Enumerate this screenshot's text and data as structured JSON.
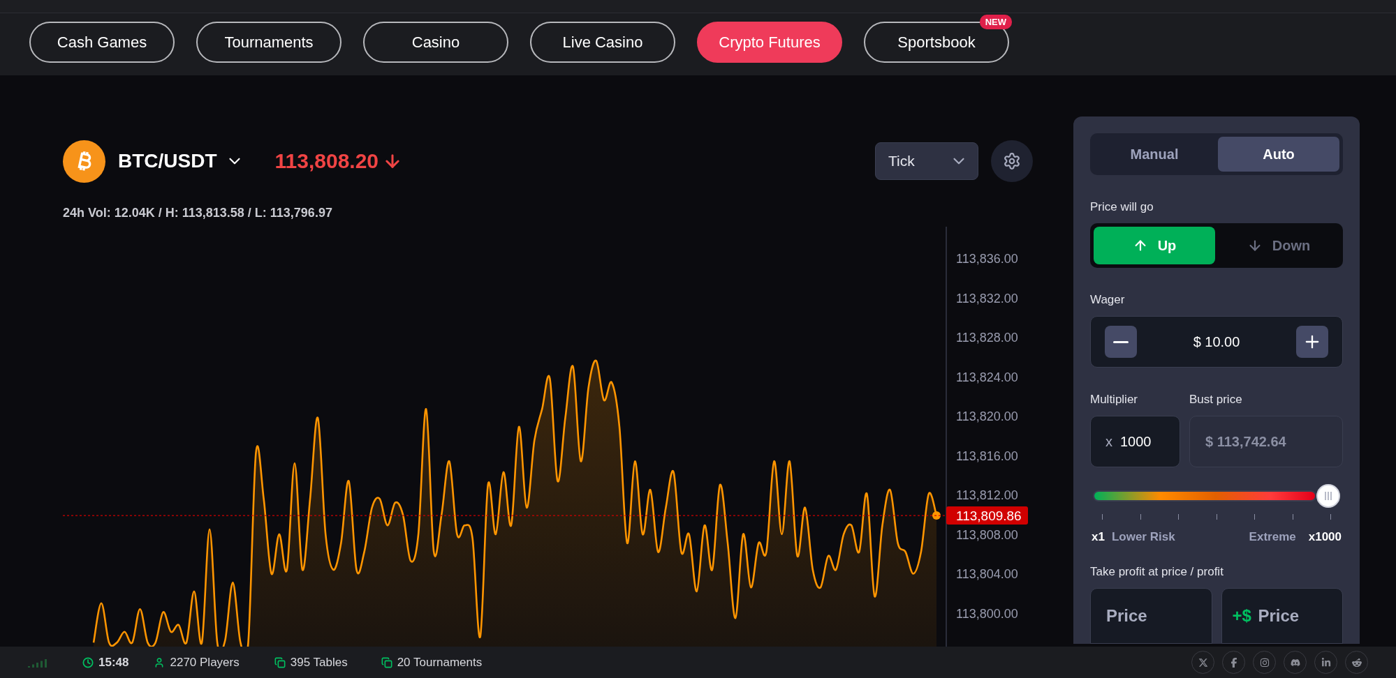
{
  "nav": {
    "tabs": [
      {
        "label": "Cash Games",
        "selected": false
      },
      {
        "label": "Tournaments",
        "selected": false
      },
      {
        "label": "Casino",
        "selected": false
      },
      {
        "label": "Live Casino",
        "selected": false
      },
      {
        "label": "Crypto Futures",
        "selected": true
      },
      {
        "label": "Sportsbook",
        "selected": false,
        "badge": "NEW"
      }
    ]
  },
  "market": {
    "pair": "BTC/USDT",
    "price": "113,808.20",
    "price_falling": true,
    "stats": "24h Vol: 12.04K / H: 113,813.58 / L: 113,796.97",
    "interval": "Tick"
  },
  "chart": {
    "current_price_label": "113,809.86",
    "chart_data": {
      "type": "area",
      "ylim": [
        113796.6,
        113839.2
      ],
      "yticks": [
        {
          "value": 113836,
          "label": "113,836.00"
        },
        {
          "value": 113832,
          "label": "113,832.00"
        },
        {
          "value": 113828,
          "label": "113,828.00"
        },
        {
          "value": 113824,
          "label": "113,824.00"
        },
        {
          "value": 113820,
          "label": "113,820.00"
        },
        {
          "value": 113816,
          "label": "113,816.00"
        },
        {
          "value": 113812,
          "label": "113,812.00"
        },
        {
          "value": 113808,
          "label": "113,808.00"
        },
        {
          "value": 113804,
          "label": "113,804.00"
        },
        {
          "value": 113800,
          "label": "113,800.00"
        }
      ],
      "series": [
        {
          "color": "#ff9500",
          "values": [
            113797.0,
            113801.0,
            113797.0,
            113797.0,
            113798.1,
            113797.0,
            113800.4,
            113797.0,
            113797.0,
            113800.1,
            113798.1,
            113798.8,
            113797.0,
            113802.2,
            113797.0,
            113808.5,
            113797.0,
            113797.2,
            113803.1,
            113797.0,
            113797.0,
            113816.3,
            113811.6,
            113804.0,
            113808.0,
            113804.4,
            113815.2,
            113804.4,
            113811.6,
            113819.8,
            113808.0,
            113804.4,
            113807.1,
            113813.4,
            113804.4,
            113806.2,
            113810.7,
            113811.6,
            113808.9,
            113811.2,
            113810.0,
            113805.3,
            113808.0,
            113820.7,
            113806.2,
            113810.0,
            113815.4,
            113808.0,
            113808.9,
            113807.6,
            113797.6,
            113813.0,
            113808.0,
            113814.3,
            113808.9,
            113818.9,
            113810.7,
            113817.5,
            113820.7,
            113823.8,
            113813.4,
            113819.8,
            113825.0,
            113815.4,
            113822.9,
            113825.6,
            113821.6,
            113823.4,
            113818.9,
            113807.1,
            113815.4,
            113808.0,
            113812.5,
            113806.2,
            113810.7,
            113814.3,
            113806.2,
            113808.0,
            113802.2,
            113808.9,
            113804.4,
            113813.0,
            113807.1,
            113799.5,
            113808.0,
            113802.6,
            113807.1,
            113806.2,
            113815.4,
            113808.0,
            113815.4,
            113805.8,
            113810.7,
            113804.4,
            113802.6,
            113805.8,
            113804.4,
            113808.0,
            113808.9,
            113806.2,
            113812.1,
            113801.7,
            113808.9,
            113812.5,
            113807.1,
            113806.2,
            113804.0,
            113806.2,
            113812.1,
            113809.9
          ]
        }
      ]
    }
  },
  "panel": {
    "modes": [
      {
        "label": "Manual",
        "selected": false
      },
      {
        "label": "Auto",
        "selected": true
      }
    ],
    "direction_label": "Price will go",
    "directions": [
      {
        "label": "Up",
        "kind": "up",
        "selected": true
      },
      {
        "label": "Down",
        "kind": "down",
        "selected": false
      }
    ],
    "wager_label": "Wager",
    "wager": "$ 10.00",
    "multiplier_label": "Multiplier",
    "multiplier_prefix": "x",
    "multiplier": "1000",
    "bust_label": "Bust price",
    "bust_price": "$ 113,742.64",
    "risk": {
      "level": 1,
      "min": "x1",
      "min_label": "Lower Risk",
      "max_label": "Extreme",
      "max": "x1000"
    },
    "take_profit_label": "Take profit at price / profit",
    "take_profit": [
      {
        "placeholder": "Price"
      },
      {
        "prefix": "+$",
        "placeholder": "Price"
      }
    ]
  },
  "status_bar": {
    "time": "15:48",
    "items": [
      {
        "kind": "players",
        "text": "2270 Players"
      },
      {
        "kind": "tables",
        "text": "395 Tables"
      },
      {
        "kind": "tournaments",
        "text": "20 Tournaments"
      }
    ],
    "socials": [
      {
        "kind": "x"
      },
      {
        "kind": "facebook"
      },
      {
        "kind": "instagram"
      },
      {
        "kind": "discord"
      },
      {
        "kind": "linkedin"
      },
      {
        "kind": "reddit"
      }
    ]
  }
}
